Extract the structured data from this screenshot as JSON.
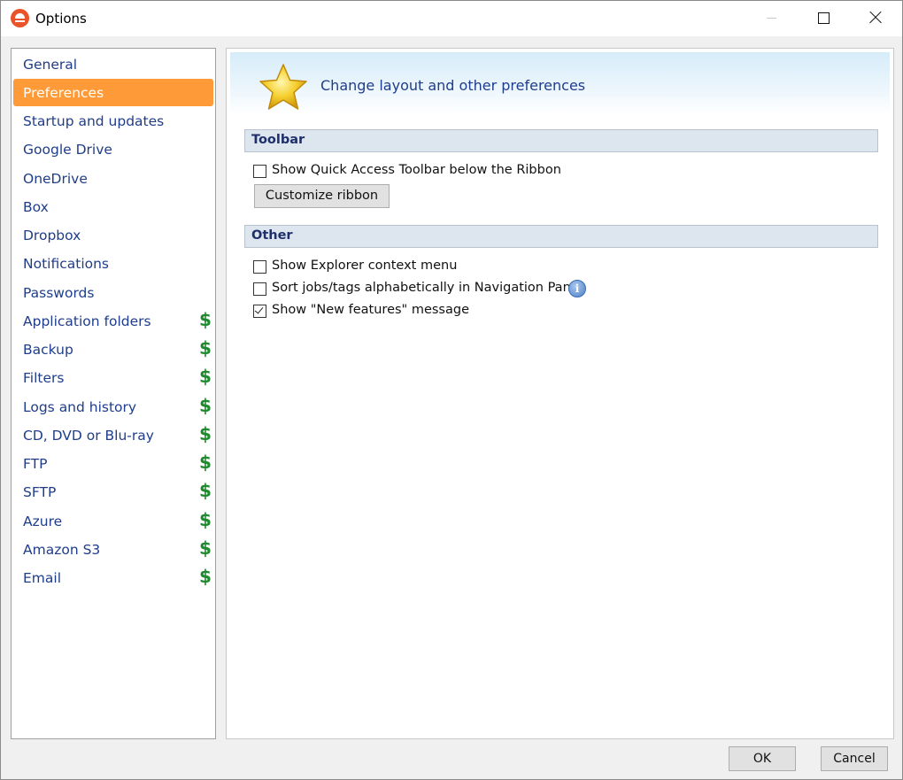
{
  "window": {
    "title": "Options"
  },
  "sidebar": {
    "items": [
      {
        "label": "General",
        "paid": false,
        "selected": false
      },
      {
        "label": "Preferences",
        "paid": false,
        "selected": true
      },
      {
        "label": "Startup and updates",
        "paid": false,
        "selected": false
      },
      {
        "label": "Google Drive",
        "paid": false,
        "selected": false
      },
      {
        "label": "OneDrive",
        "paid": false,
        "selected": false
      },
      {
        "label": "Box",
        "paid": false,
        "selected": false
      },
      {
        "label": "Dropbox",
        "paid": false,
        "selected": false
      },
      {
        "label": "Notifications",
        "paid": false,
        "selected": false
      },
      {
        "label": "Passwords",
        "paid": false,
        "selected": false
      },
      {
        "label": "Application folders",
        "paid": true,
        "selected": false
      },
      {
        "label": "Backup",
        "paid": true,
        "selected": false
      },
      {
        "label": "Filters",
        "paid": true,
        "selected": false
      },
      {
        "label": "Logs and history",
        "paid": true,
        "selected": false
      },
      {
        "label": "CD, DVD or Blu-ray",
        "paid": true,
        "selected": false
      },
      {
        "label": "FTP",
        "paid": true,
        "selected": false
      },
      {
        "label": "SFTP",
        "paid": true,
        "selected": false
      },
      {
        "label": "Azure",
        "paid": true,
        "selected": false
      },
      {
        "label": "Amazon S3",
        "paid": true,
        "selected": false
      },
      {
        "label": "Email",
        "paid": true,
        "selected": false
      }
    ],
    "paid_symbol": "$"
  },
  "main": {
    "header_text": "Change layout and other preferences",
    "toolbar_section": {
      "title": "Toolbar",
      "quick_access_label": "Show Quick Access Toolbar below the Ribbon",
      "quick_access_checked": false,
      "customize_button": "Customize ribbon"
    },
    "other_section": {
      "title": "Other",
      "options": [
        {
          "label": "Show Explorer context menu",
          "checked": false
        },
        {
          "label": "Sort jobs/tags alphabetically in Navigation Pane",
          "checked": false,
          "info": true
        },
        {
          "label": "Show \"New features\" message",
          "checked": true
        }
      ],
      "info_symbol": "i"
    }
  },
  "footer": {
    "ok_label": "OK",
    "cancel_label": "Cancel"
  },
  "colors": {
    "selected_bg": "#ff9a38",
    "link_text": "#1f3d8a",
    "paid_icon": "#1e8a2d"
  }
}
